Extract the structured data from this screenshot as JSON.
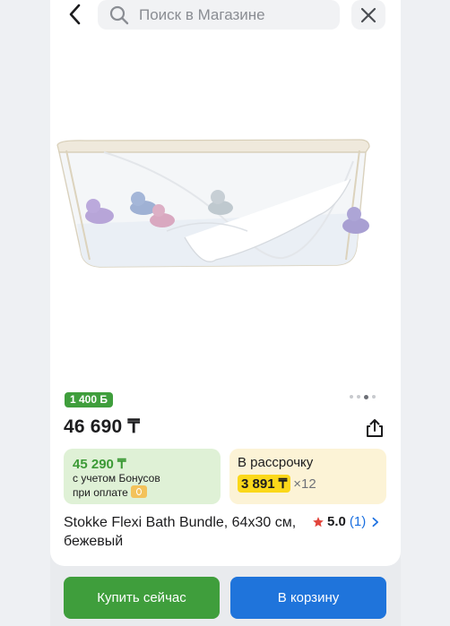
{
  "header": {
    "search_placeholder": "Поиск в Магазине"
  },
  "icons": {
    "back": "chevron-left-icon",
    "search": "magnifier-icon",
    "close": "close-x-icon",
    "share": "share-icon",
    "star": "star-icon",
    "chevron": "chevron-right-icon"
  },
  "product": {
    "bonus_badge": "1 400 Б",
    "image_dots": {
      "count": 4,
      "active_index": 2
    },
    "price": "46 690 ₸",
    "bonus_offer": {
      "price": "45 290 ₸",
      "note_line1": "с учетом Бонусов",
      "note_line2": "при оплате"
    },
    "installment": {
      "label": "В рассрочку",
      "amount": "3 891 ₸",
      "times": "×12"
    },
    "title": "Stokke Flexi Bath Bundle, 64x30 см, бежевый",
    "rating": {
      "value": "5.0",
      "count": "(1)"
    }
  },
  "actions": {
    "buy_now": "Купить сейчас",
    "add_to_cart": "В корзину"
  },
  "colors": {
    "green": "#3f9e3c",
    "blue": "#1f74db",
    "bonus_bg": "#dff1d6",
    "installment_bg": "#fcf3d6",
    "installment_highlight": "#fbd81a",
    "star": "#e2453c"
  }
}
